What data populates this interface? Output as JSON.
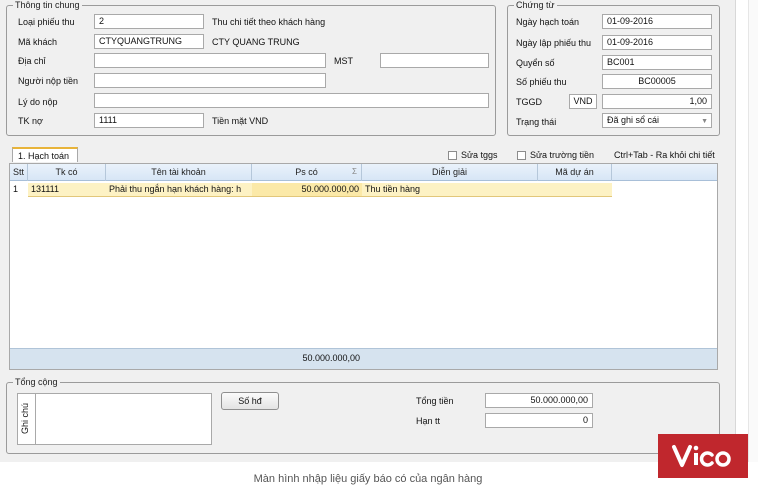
{
  "general": {
    "legend": "Thông tin chung",
    "loai_phieu_thu_label": "Loại phiếu thu",
    "loai_phieu_thu_value": "2",
    "loai_phieu_thu_desc": "Thu chi tiết theo khách hàng",
    "ma_khach_label": "Mã khách",
    "ma_khach_value": "CTYQUANGTRUNG",
    "ma_khach_name": "CTY QUANG TRUNG",
    "dia_chi_label": "Địa chỉ",
    "dia_chi_value": "",
    "mst_label": "MST",
    "mst_value": "",
    "nguoi_nop_label": "Người nộp tiền",
    "nguoi_nop_value": "",
    "ly_do_label": "Lý do nộp",
    "ly_do_value": "",
    "tk_no_label": "TK nợ",
    "tk_no_value": "1111",
    "tk_no_desc": "Tiền mặt VND"
  },
  "voucher": {
    "legend": "Chứng từ",
    "ngay_hach_toan_label": "Ngày hạch toán",
    "ngay_hach_toan_value": "01-09-2016",
    "ngay_lap_label": "Ngày lập phiếu thu",
    "ngay_lap_value": "01-09-2016",
    "quyen_so_label": "Quyển số",
    "quyen_so_value": "BC001",
    "so_phieu_label": "Số phiếu thu",
    "so_phieu_value": "BC00005",
    "tggd_label": "TGGD",
    "currency": "VND",
    "rate": "1,00",
    "trang_thai_label": "Trạng thái",
    "trang_thai_value": "Đã ghi sổ cái"
  },
  "tabs": [
    {
      "label": "1. Hạch toán"
    }
  ],
  "options": {
    "sua_tggs": "Sửa tggs",
    "sua_truong_tien": "Sửa trường tiền",
    "hint": "Ctrl+Tab - Ra khỏi chi tiết"
  },
  "grid": {
    "columns": [
      "Stt",
      "Tk có",
      "Tên tài khoản",
      "Ps có",
      "Diễn giải",
      "Mã dự án"
    ],
    "sum_symbol": "Σ",
    "rows": [
      {
        "stt": "1",
        "tk_co": "131111",
        "ten_tk": "Phải thu ngắn hạn khách hàng: h",
        "ps_co": "50.000.000,00",
        "dien_giai": "Thu tiền hàng",
        "ma_du_an": ""
      }
    ],
    "footer_total": "50.000.000,00"
  },
  "summary": {
    "legend": "Tổng cộng",
    "ghi_chu_label": "Ghi chú",
    "so_hd_button": "Số hđ",
    "tong_tien_label": "Tổng tiền",
    "tong_tien_value": "50.000.000,00",
    "han_tt_label": "Hạn tt",
    "han_tt_value": "0"
  },
  "caption": "Màn hình nhập liệu giấy báo có của ngân hàng",
  "logo": {
    "text": "Vico",
    "color": "#c0272d"
  }
}
